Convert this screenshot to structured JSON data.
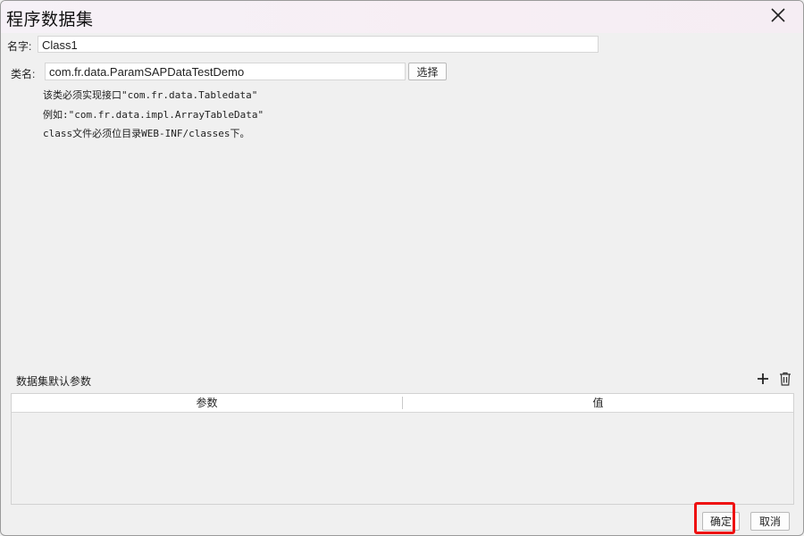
{
  "dialog": {
    "title": "程序数据集"
  },
  "form": {
    "name_label": "名字:",
    "name_value": "Class1",
    "class_label": "类名:",
    "class_value": "com.fr.data.ParamSAPDataTestDemo",
    "choose_button": "选择"
  },
  "hints": [
    "该类必须实现接口\"com.fr.data.Tabledata\"",
    "例如:\"com.fr.data.impl.ArrayTableData\"",
    "class文件必须位目录WEB-INF/classes下。"
  ],
  "params": {
    "section_title": "数据集默认参数",
    "columns": [
      "参数",
      "值"
    ],
    "rows": []
  },
  "footer": {
    "ok_label": "确定",
    "cancel_label": "取消"
  },
  "icons": {
    "close": "close-icon",
    "add": "plus-icon",
    "delete": "trash-icon"
  },
  "colors": {
    "highlight": "#ee1111"
  }
}
